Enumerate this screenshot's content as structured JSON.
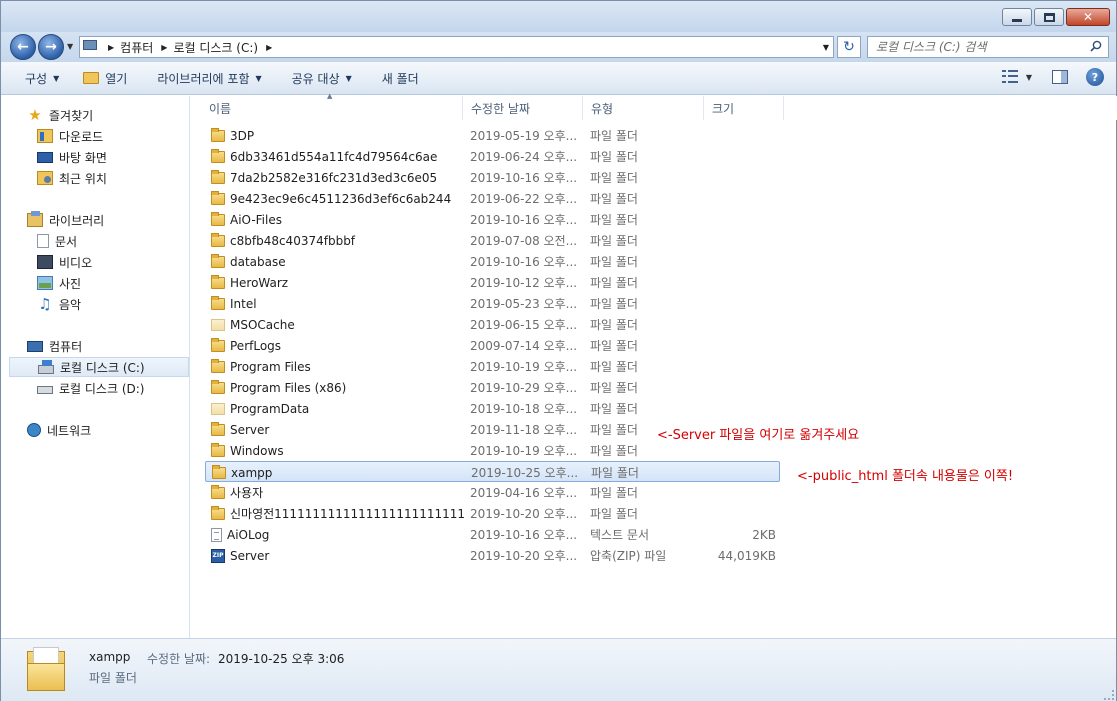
{
  "window": {
    "buttons": {
      "minimize": "minimize",
      "maximize": "maximize",
      "close": "✕"
    }
  },
  "address": {
    "crumbs": [
      "컴퓨터",
      "로컬 디스크 (C:)"
    ],
    "back_icon": "back-arrow-icon",
    "forward_icon": "forward-arrow-icon",
    "refresh_icon": "refresh-icon"
  },
  "search": {
    "placeholder": "로컬 디스크 (C:) 검색"
  },
  "toolbar": {
    "organize": "구성",
    "open": "열기",
    "include_library": "라이브러리에 포함",
    "share": "공유 대상",
    "new_folder": "새 폴더"
  },
  "nav": {
    "favorites": "즐겨찾기",
    "downloads": "다운로드",
    "desktop": "바탕 화면",
    "recent": "최근 위치",
    "libraries": "라이브러리",
    "documents": "문서",
    "videos": "비디오",
    "pictures": "사진",
    "music": "음악",
    "computer": "컴퓨터",
    "drive_c": "로컬 디스크 (C:)",
    "drive_d": "로컬 디스크 (D:)",
    "network": "네트워크"
  },
  "columns": {
    "name": "이름",
    "modified": "수정한 날짜",
    "type": "유형",
    "size": "크기"
  },
  "files": [
    {
      "name": "3DP",
      "date": "2019-05-19 오후...",
      "type": "파일 폴더",
      "size": "",
      "icon": "folder"
    },
    {
      "name": "6db33461d554a11fc4d79564c6ae",
      "date": "2019-06-24 오후...",
      "type": "파일 폴더",
      "size": "",
      "icon": "folder"
    },
    {
      "name": "7da2b2582e316fc231d3ed3c6e05",
      "date": "2019-10-16 오후...",
      "type": "파일 폴더",
      "size": "",
      "icon": "folder"
    },
    {
      "name": "9e423ec9e6c4511236d3ef6c6ab244",
      "date": "2019-06-22 오후...",
      "type": "파일 폴더",
      "size": "",
      "icon": "folder"
    },
    {
      "name": "AiO-Files",
      "date": "2019-10-16 오후...",
      "type": "파일 폴더",
      "size": "",
      "icon": "folder"
    },
    {
      "name": "c8bfb48c40374fbbbf",
      "date": "2019-07-08 오전...",
      "type": "파일 폴더",
      "size": "",
      "icon": "folder"
    },
    {
      "name": "database",
      "date": "2019-10-16 오후...",
      "type": "파일 폴더",
      "size": "",
      "icon": "folder"
    },
    {
      "name": "HeroWarz",
      "date": "2019-10-12 오후...",
      "type": "파일 폴더",
      "size": "",
      "icon": "folder"
    },
    {
      "name": "Intel",
      "date": "2019-05-23 오후...",
      "type": "파일 폴더",
      "size": "",
      "icon": "folder"
    },
    {
      "name": "MSOCache",
      "date": "2019-06-15 오후...",
      "type": "파일 폴더",
      "size": "",
      "icon": "folder-faded"
    },
    {
      "name": "PerfLogs",
      "date": "2009-07-14 오후...",
      "type": "파일 폴더",
      "size": "",
      "icon": "folder"
    },
    {
      "name": "Program Files",
      "date": "2019-10-19 오후...",
      "type": "파일 폴더",
      "size": "",
      "icon": "folder"
    },
    {
      "name": "Program Files (x86)",
      "date": "2019-10-29 오후...",
      "type": "파일 폴더",
      "size": "",
      "icon": "folder"
    },
    {
      "name": "ProgramData",
      "date": "2019-10-18 오후...",
      "type": "파일 폴더",
      "size": "",
      "icon": "folder-faded"
    },
    {
      "name": "Server",
      "date": "2019-11-18 오후...",
      "type": "파일 폴더",
      "size": "",
      "icon": "folder"
    },
    {
      "name": "Windows",
      "date": "2019-10-19 오후...",
      "type": "파일 폴더",
      "size": "",
      "icon": "folder"
    },
    {
      "name": "xampp",
      "date": "2019-10-25 오후...",
      "type": "파일 폴더",
      "size": "",
      "icon": "folder"
    },
    {
      "name": "사용자",
      "date": "2019-04-16 오후...",
      "type": "파일 폴더",
      "size": "",
      "icon": "folder"
    },
    {
      "name": "신마영전1111111111111111111111111",
      "date": "2019-10-20 오후...",
      "type": "파일 폴더",
      "size": "",
      "icon": "folder"
    },
    {
      "name": "AiOLog",
      "date": "2019-10-16 오후...",
      "type": "텍스트 문서",
      "size": "2KB",
      "icon": "text-file"
    },
    {
      "name": "Server",
      "date": "2019-10-20 오후...",
      "type": "압축(ZIP) 파일",
      "size": "44,019KB",
      "icon": "zip"
    }
  ],
  "annotations": {
    "server_note": "<-Server 파일을 여기로 옮겨주세요",
    "xampp_note": "<-public_html 폴더속 내용물은 이쪽!"
  },
  "details": {
    "name": "xampp",
    "modified_label": "수정한 날짜:",
    "modified_value": "2019-10-25 오후 3:06",
    "type": "파일 폴더"
  },
  "colors": {
    "annotation": "#d40000",
    "selection": "#d3e4f8"
  }
}
